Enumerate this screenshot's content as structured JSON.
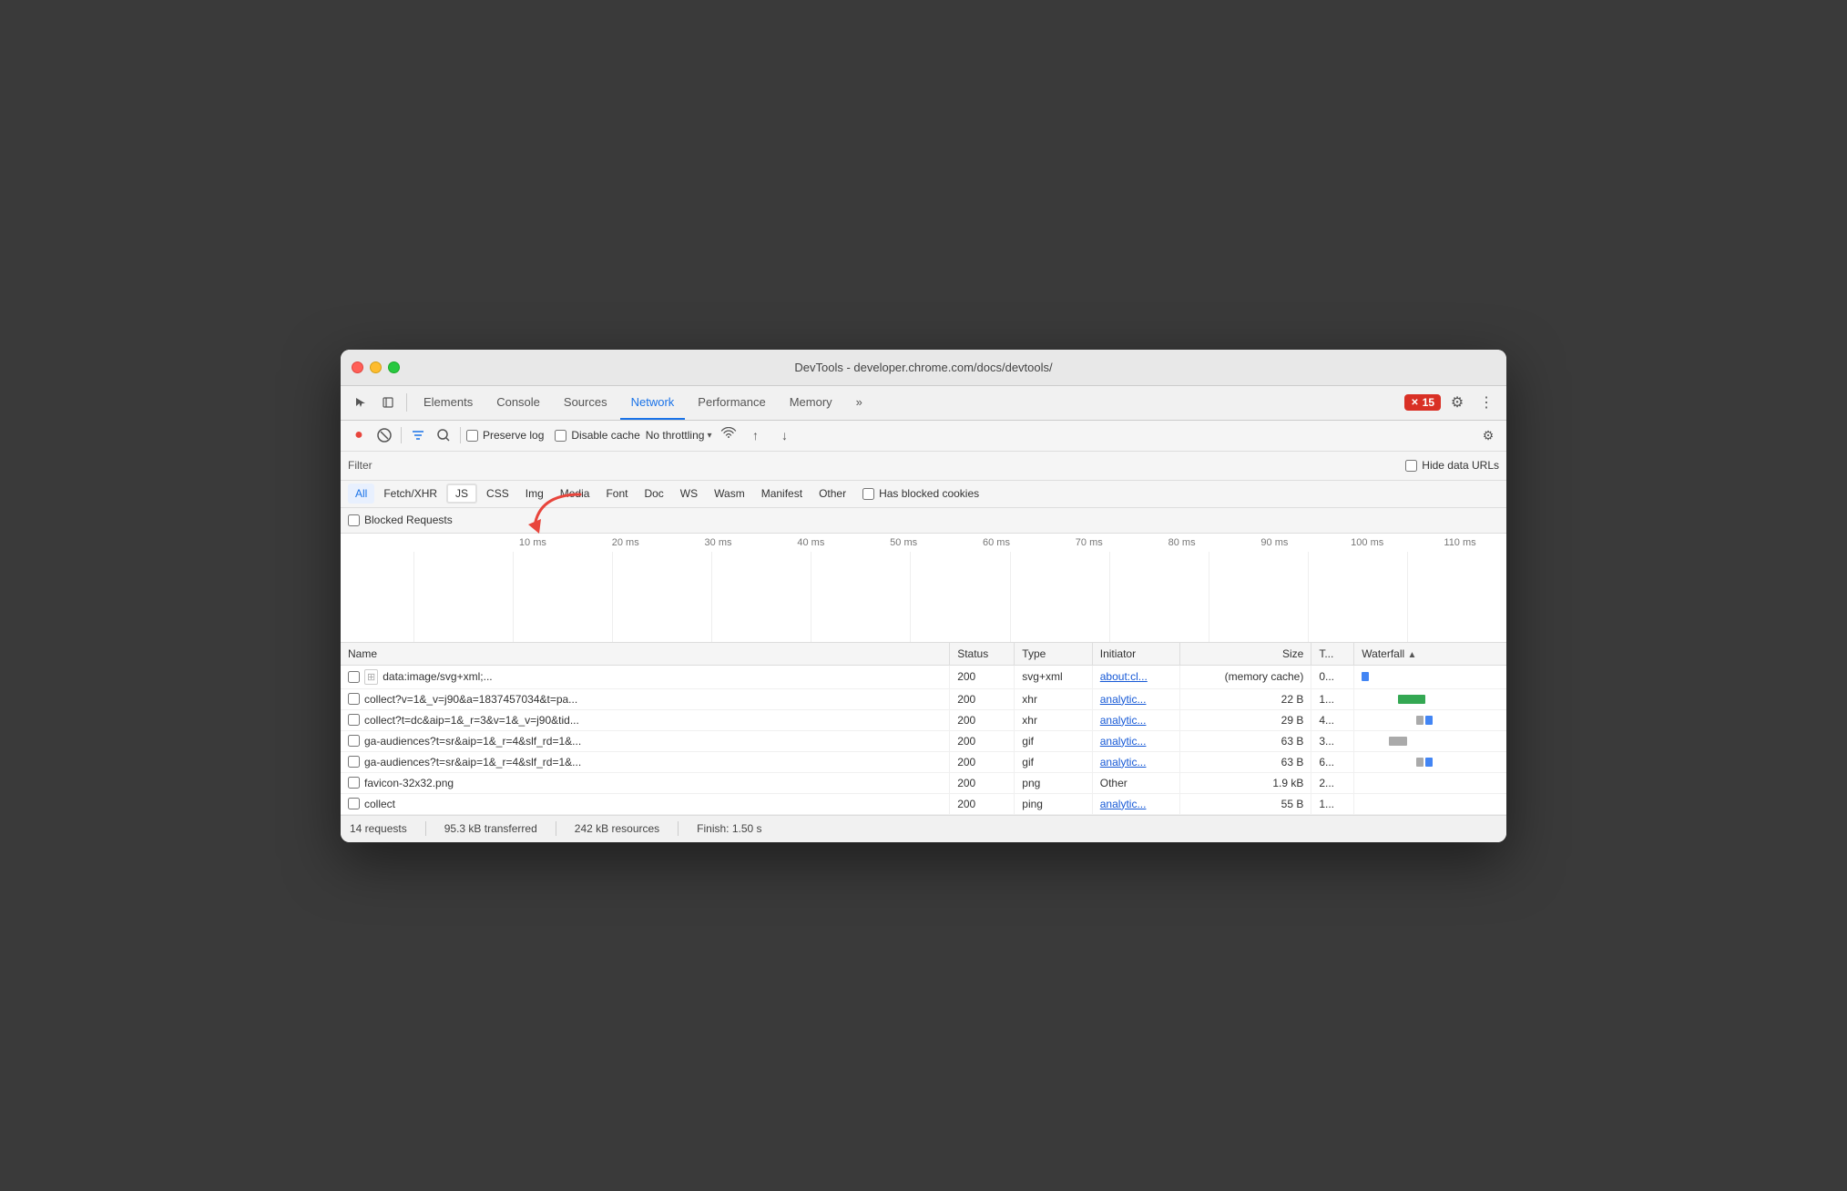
{
  "window": {
    "title": "DevTools - developer.chrome.com/docs/devtools/"
  },
  "nav": {
    "tabs": [
      {
        "label": "Elements",
        "active": false
      },
      {
        "label": "Console",
        "active": false
      },
      {
        "label": "Sources",
        "active": false
      },
      {
        "label": "Network",
        "active": true
      },
      {
        "label": "Performance",
        "active": false
      },
      {
        "label": "Memory",
        "active": false
      },
      {
        "label": "»",
        "active": false
      }
    ],
    "error_count": "15",
    "settings_label": "⚙",
    "more_label": "⋮"
  },
  "toolbar": {
    "record_label": "●",
    "clear_label": "🚫",
    "filter_label": "▼",
    "search_label": "🔍",
    "preserve_log": "Preserve log",
    "disable_cache": "Disable cache",
    "throttle_label": "No throttling",
    "throttle_arrow": "▾",
    "wifi_icon": "wifi",
    "upload_icon": "↑",
    "download_icon": "↓",
    "settings_label": "⚙"
  },
  "filter_bar": {
    "filter_label": "Filter",
    "hide_urls_label": "Hide data URLs"
  },
  "type_filters": [
    {
      "label": "All",
      "active": true
    },
    {
      "label": "Fetch/XHR",
      "active": false
    },
    {
      "label": "JS",
      "active": false
    },
    {
      "label": "CSS",
      "active": false
    },
    {
      "label": "Img",
      "active": false
    },
    {
      "label": "Media",
      "active": false
    },
    {
      "label": "Font",
      "active": false
    },
    {
      "label": "Doc",
      "active": false
    },
    {
      "label": "WS",
      "active": false
    },
    {
      "label": "Wasm",
      "active": false
    },
    {
      "label": "Manifest",
      "active": false
    },
    {
      "label": "Other",
      "active": false
    },
    {
      "label": "Has blocked cookies",
      "active": false,
      "is_checkbox": true
    }
  ],
  "blocked_requests": {
    "label": "Blocked Requests"
  },
  "timeline": {
    "labels": [
      "10 ms",
      "20 ms",
      "30 ms",
      "40 ms",
      "50 ms",
      "60 ms",
      "70 ms",
      "80 ms",
      "90 ms",
      "100 ms",
      "110 ms"
    ]
  },
  "table": {
    "headers": [
      {
        "label": "Name"
      },
      {
        "label": "Status"
      },
      {
        "label": "Type"
      },
      {
        "label": "Initiator"
      },
      {
        "label": "Size"
      },
      {
        "label": "T..."
      },
      {
        "label": "Waterfall",
        "has_sort": true
      }
    ],
    "rows": [
      {
        "name": "data:image/svg+xml;...",
        "has_icon": true,
        "status": "200",
        "type": "svg+xml",
        "initiator": "about:cl...",
        "initiator_link": true,
        "size": "(memory cache)",
        "time": "0...",
        "waterfall_type": "blue"
      },
      {
        "name": "collect?v=1&_v=j90&a=1837457034&t=pa...",
        "has_icon": false,
        "status": "200",
        "type": "xhr",
        "initiator": "analytic...",
        "initiator_link": true,
        "size": "22 B",
        "time": "1...",
        "waterfall_type": "green"
      },
      {
        "name": "collect?t=dc&aip=1&_r=3&v=1&_v=j90&tid...",
        "has_icon": false,
        "status": "200",
        "type": "xhr",
        "initiator": "analytic...",
        "initiator_link": true,
        "size": "29 B",
        "time": "4...",
        "waterfall_type": "gray_double"
      },
      {
        "name": "ga-audiences?t=sr&aip=1&_r=4&slf_rd=1&...",
        "has_icon": false,
        "status": "200",
        "type": "gif",
        "initiator": "analytic...",
        "initiator_link": true,
        "size": "63 B",
        "time": "3...",
        "waterfall_type": "gray"
      },
      {
        "name": "ga-audiences?t=sr&aip=1&_r=4&slf_rd=1&...",
        "has_icon": false,
        "status": "200",
        "type": "gif",
        "initiator": "analytic...",
        "initiator_link": true,
        "size": "63 B",
        "time": "6...",
        "waterfall_type": "gray_double"
      },
      {
        "name": "favicon-32x32.png",
        "has_icon": false,
        "status": "200",
        "type": "png",
        "initiator": "Other",
        "initiator_link": false,
        "size": "1.9 kB",
        "time": "2...",
        "waterfall_type": "none"
      },
      {
        "name": "collect",
        "has_icon": false,
        "status": "200",
        "type": "ping",
        "initiator": "analytic...",
        "initiator_link": true,
        "size": "55 B",
        "time": "1...",
        "waterfall_type": "none"
      }
    ]
  },
  "status_bar": {
    "requests": "14 requests",
    "transferred": "95.3 kB transferred",
    "resources": "242 kB resources",
    "finish": "Finish: 1.50 s"
  }
}
